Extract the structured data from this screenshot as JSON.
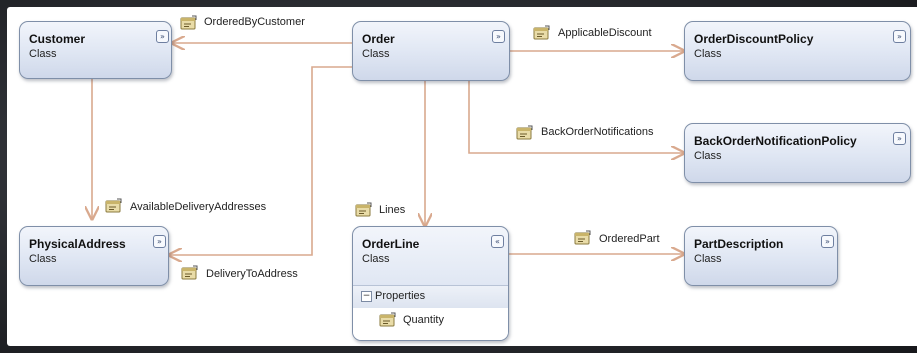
{
  "classes": {
    "customer": {
      "name": "Customer",
      "kind": "Class",
      "toggle": "»"
    },
    "order": {
      "name": "Order",
      "kind": "Class",
      "toggle": "»"
    },
    "order_discount_policy": {
      "name": "OrderDiscountPolicy",
      "kind": "Class",
      "toggle": "»"
    },
    "back_order_notification_policy": {
      "name": "BackOrderNotificationPolicy",
      "kind": "Class",
      "toggle": "»"
    },
    "physical_address": {
      "name": "PhysicalAddress",
      "kind": "Class",
      "toggle": "»"
    },
    "order_line": {
      "name": "OrderLine",
      "kind": "Class",
      "toggle": "«",
      "section": {
        "expander": "−",
        "label": "Properties"
      },
      "properties": [
        "Quantity"
      ]
    },
    "part_description": {
      "name": "PartDescription",
      "kind": "Class",
      "toggle": "»"
    }
  },
  "associations": {
    "ordered_by_customer": "OrderedByCustomer",
    "applicable_discount": "ApplicableDiscount",
    "back_order_notifications": "BackOrderNotifications",
    "available_delivery_addresses": "AvailableDeliveryAddresses",
    "delivery_to_address": "DeliveryToAddress",
    "lines": "Lines",
    "ordered_part": "OrderedPart"
  },
  "colors": {
    "connector": "#d9a98e",
    "box_border": "#7f8fa8",
    "box_fill_top": "#f2f5fb",
    "box_fill_bottom": "#cfd8ea"
  },
  "icons": {
    "association_icon": "property-association-icon",
    "toggle_icon": "collapse-toggle-icon"
  }
}
